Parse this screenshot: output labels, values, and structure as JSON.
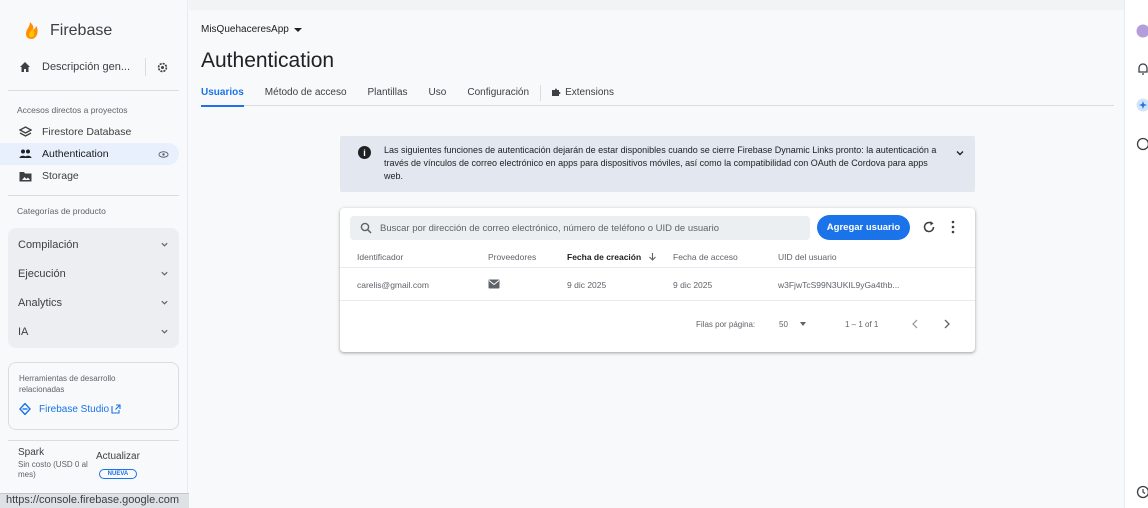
{
  "brand": {
    "name": "Firebase"
  },
  "sidebar": {
    "overview_label": "Descripción gen...",
    "shortcuts_title": "Accesos directos a proyectos",
    "shortcuts": [
      {
        "label": "Firestore Database"
      },
      {
        "label": "Authentication"
      },
      {
        "label": "Storage"
      }
    ],
    "categories_title": "Categorías de producto",
    "categories": [
      {
        "label": "Compilación"
      },
      {
        "label": "Ejecución"
      },
      {
        "label": "Analytics"
      },
      {
        "label": "IA"
      }
    ],
    "tools_title": "Herramientas de desarrollo relacionadas",
    "studio_label": "Firebase Studio",
    "plan_name": "Spark",
    "plan_cost": "Sin costo (USD 0 al mes)",
    "upgrade_label": "Actualizar",
    "upgrade_badge": "NUEVA"
  },
  "status_url": "https://console.firebase.google.com",
  "header": {
    "project": "MisQuehaceresApp",
    "title": "Authentication",
    "tabs": [
      {
        "label": "Usuarios"
      },
      {
        "label": "Método de acceso"
      },
      {
        "label": "Plantillas"
      },
      {
        "label": "Uso"
      },
      {
        "label": "Configuración"
      },
      {
        "label": "Extensions"
      }
    ]
  },
  "banner": {
    "text": "Las siguientes funciones de autenticación dejarán de estar disponibles cuando se cierre Firebase Dynamic Links pronto: la autenticación a través de vínculos de correo electrónico en apps para dispositivos móviles, así como la compatibilidad con OAuth de Cordova para apps web."
  },
  "users": {
    "search_placeholder": "Buscar por dirección de correo electrónico, número de teléfono o UID de usuario",
    "add_button": "Agregar usuario",
    "columns": [
      "Identificador",
      "Proveedores",
      "Fecha de creación",
      "Fecha de acceso",
      "UID del usuario"
    ],
    "rows": [
      {
        "identifier": "carelis@gmail.com",
        "provider_icon": "email-icon",
        "created": "9 dic 2025",
        "signed_in": "9 dic 2025",
        "uid": "w3FjwTcS99N3UKIL9yGa4thb..."
      }
    ],
    "pager": {
      "rows_per_page_label": "Filas por página:",
      "rows_per_page": "50",
      "range": "1 – 1 of 1"
    }
  },
  "colors": {
    "accent": "#1a73e8",
    "active_nav": "#e8f0fe",
    "banner_bg": "#e3e8f0"
  }
}
